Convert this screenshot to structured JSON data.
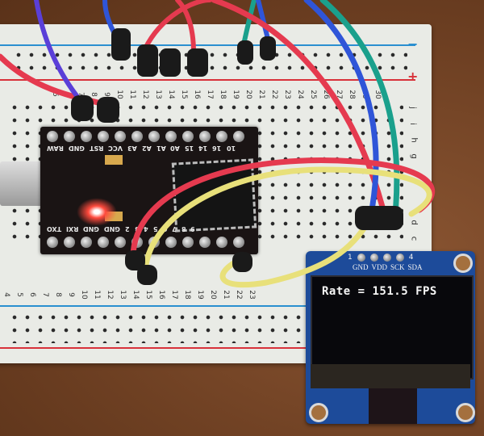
{
  "scene": {
    "description": "Photo of a Pro Micro microcontroller on a breadboard wired to an OLED display",
    "colors": {
      "table": "#6d3f22",
      "breadboard": "#e9ebe6",
      "rail_blue": "#2a8fd0",
      "rail_red": "#d8323a",
      "pcb": "#1a1414",
      "oled_pcb": "#1d4b9a",
      "wire_red": "#e53a4f",
      "wire_yellow": "#e8e07a",
      "wire_blue": "#2f55d8",
      "wire_teal": "#1aa08c"
    }
  },
  "breadboard": {
    "top_column_numbers": [
      "5",
      "6",
      "7",
      "8",
      "9",
      "10",
      "11",
      "12",
      "13",
      "14",
      "15",
      "16",
      "17",
      "18",
      "19",
      "20",
      "21",
      "22",
      "23",
      "24",
      "25",
      "26",
      "27",
      "28",
      "29",
      "30"
    ],
    "bottom_column_numbers": [
      "4",
      "5",
      "6",
      "7",
      "8",
      "9",
      "10",
      "11",
      "12",
      "13",
      "14",
      "15",
      "16",
      "17",
      "18",
      "19",
      "20",
      "21",
      "22",
      "23"
    ],
    "row_labels_top": [
      "j",
      "i",
      "h",
      "g"
    ],
    "row_labels_bottom": [
      "d",
      "c"
    ],
    "rail_minus": "−",
    "rail_plus": "+"
  },
  "mcu_board": {
    "top_pin_labels": [
      "RAW",
      "GND",
      "RST",
      "VCC",
      "A3",
      "A2",
      "A1",
      "A0",
      "15",
      "14",
      "16",
      "10"
    ],
    "bottom_pin_labels": [
      "TXO",
      "RXI",
      "GND",
      "GND",
      "2",
      "3",
      "4",
      "5",
      "6",
      "7",
      "8",
      "9"
    ]
  },
  "oled": {
    "pin_index_start": "1",
    "pin_index_end": "4",
    "pin_names": [
      "GND",
      "VDD",
      "SCK",
      "SDA"
    ],
    "display_text": "Rate = 151.5 FPS"
  }
}
